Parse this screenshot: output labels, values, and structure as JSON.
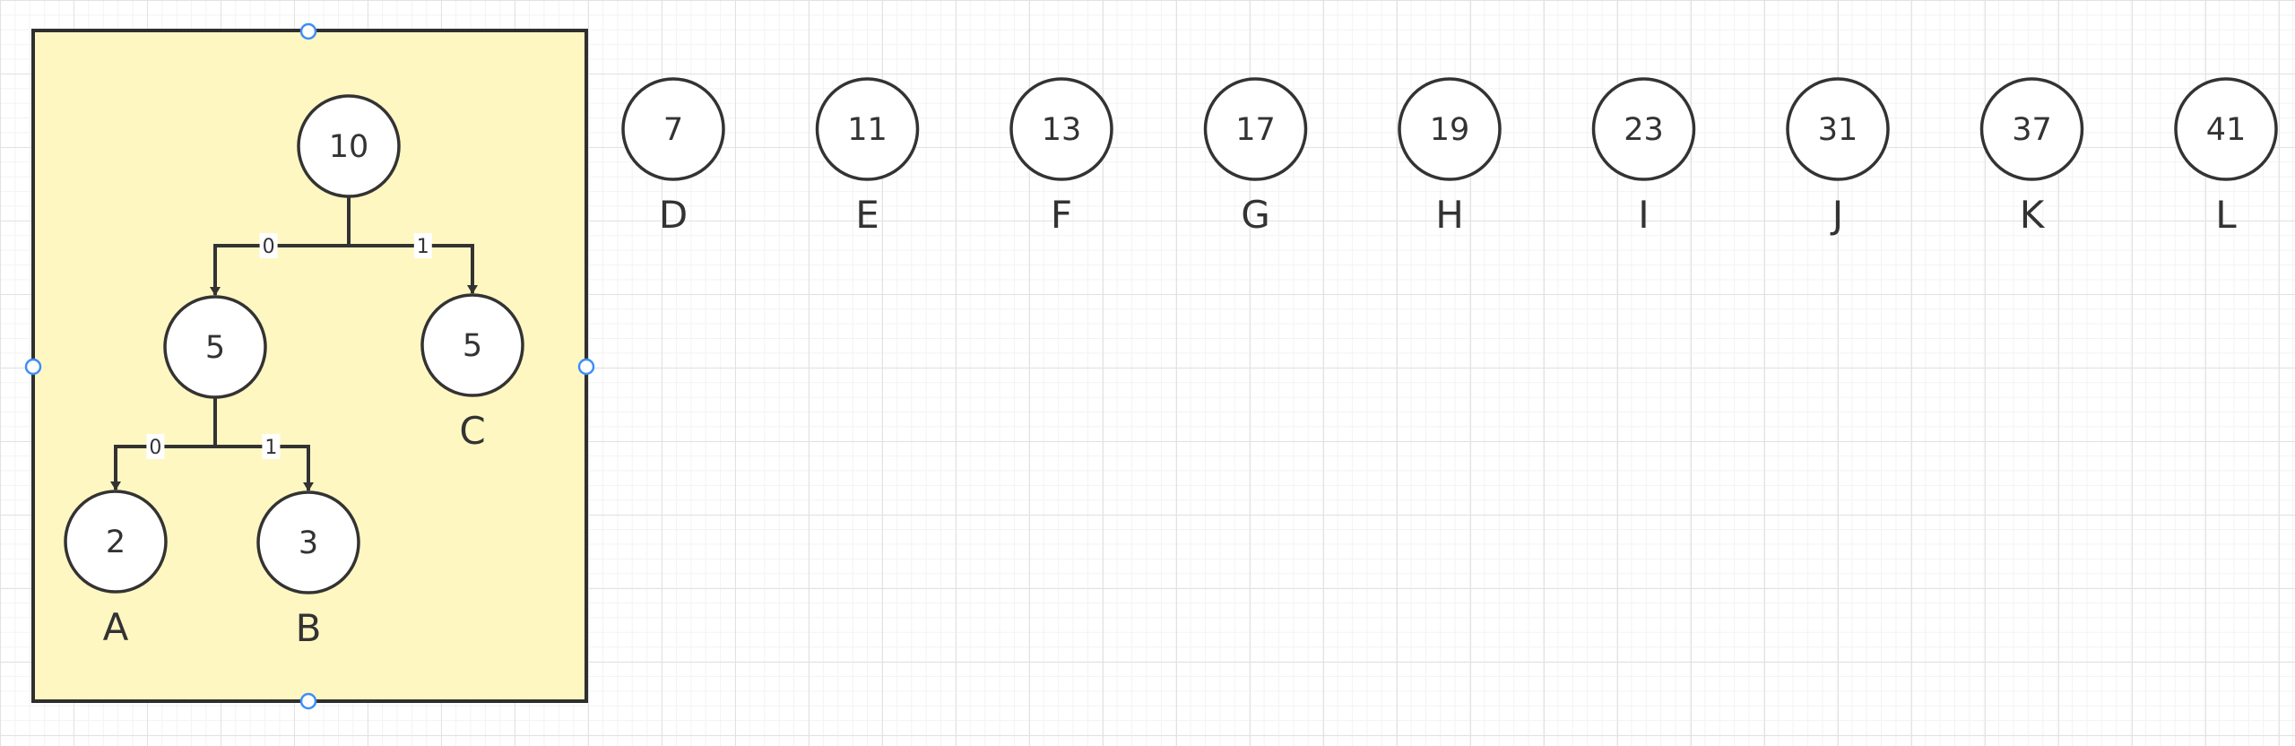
{
  "group": {
    "fill": "#fff7c2",
    "stroke": "#2f2f2f",
    "tree_nodes": [
      {
        "id": "root",
        "value": "10",
        "label": ""
      },
      {
        "id": "n5a",
        "value": "5",
        "label": ""
      },
      {
        "id": "n5b",
        "value": "5",
        "label": "C"
      },
      {
        "id": "n2",
        "value": "2",
        "label": "A"
      },
      {
        "id": "n3",
        "value": "3",
        "label": "B"
      }
    ],
    "edges": [
      {
        "from": "root",
        "to": "n5a",
        "label": "0"
      },
      {
        "from": "root",
        "to": "n5b",
        "label": "1"
      },
      {
        "from": "n5a",
        "to": "n2",
        "label": "0"
      },
      {
        "from": "n5a",
        "to": "n3",
        "label": "1"
      }
    ]
  },
  "loose_nodes": [
    {
      "value": "7",
      "label": "D"
    },
    {
      "value": "11",
      "label": "E"
    },
    {
      "value": "13",
      "label": "F"
    },
    {
      "value": "17",
      "label": "G"
    },
    {
      "value": "19",
      "label": "H"
    },
    {
      "value": "23",
      "label": "I"
    },
    {
      "value": "31",
      "label": "J"
    },
    {
      "value": "37",
      "label": "K"
    },
    {
      "value": "41",
      "label": "L"
    }
  ],
  "colors": {
    "stroke": "#333333",
    "selection_handle": "#3d8ef8"
  }
}
